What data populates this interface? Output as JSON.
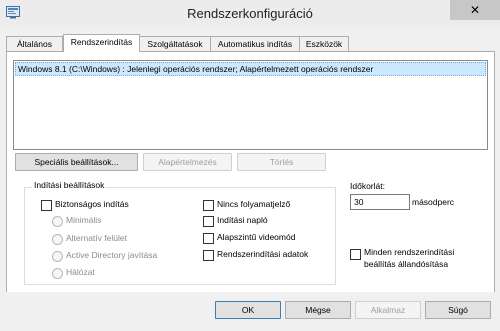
{
  "window": {
    "title": "Rendszerkonfiguráció",
    "close_glyph": "✕"
  },
  "tabs": [
    {
      "label": "Általános"
    },
    {
      "label": "Rendszerindítás"
    },
    {
      "label": "Szolgáltatások"
    },
    {
      "label": "Automatikus indítás"
    },
    {
      "label": "Eszközök"
    }
  ],
  "boot": {
    "entries": [
      "Windows 8.1 (C:\\Windows) : Jelenlegi operációs rendszer; Alapértelmezett operációs rendszer"
    ],
    "advanced_button": "Speciális beállítások...",
    "default_button": "Alapértelmezés",
    "delete_button": "Törlés"
  },
  "boot_options": {
    "group_label": "Indítási beállítások",
    "safe_boot": "Biztonságos indítás",
    "minimal": "Minimális",
    "alternate_shell": "Alternatív felület",
    "ad_repair": "Active Directory javítása",
    "network": "Hálózat",
    "no_gui": "Nincs folyamatjelző",
    "boot_log": "Indítási napló",
    "base_video": "Alapszintű videomód",
    "os_boot_info": "Rendszerindítási adatok"
  },
  "timeout": {
    "label": "Időkorlát:",
    "value": "30",
    "unit": "másodperc"
  },
  "permanent": {
    "line1": "Minden rendszerindítási",
    "line2": "beállítás állandósítása"
  },
  "footer": {
    "ok": "OK",
    "cancel": "Mégse",
    "apply": "Alkalmaz",
    "help": "Súgó"
  }
}
